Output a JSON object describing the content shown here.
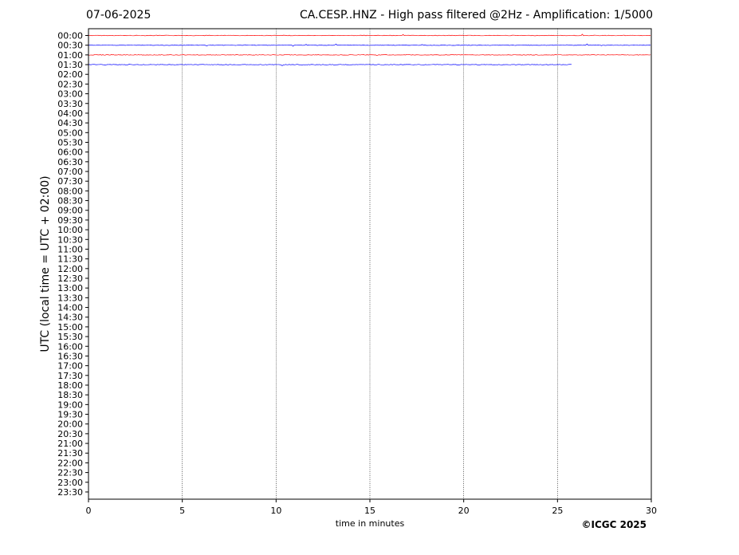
{
  "header": {
    "date": "07-06-2025",
    "title": "CA.CESP..HNZ - High pass filtered @2Hz - Amplification: 1/5000"
  },
  "copyright": "©ICGC 2025",
  "chart_data": {
    "type": "line",
    "title": "CA.CESP..HNZ - High pass filtered @2Hz - Amplification: 1/5000",
    "xlabel": "time in minutes",
    "ylabel": "UTC (local time = UTC + 02:00)",
    "xlim": [
      0,
      30
    ],
    "x_ticks": [
      0,
      5,
      10,
      15,
      20,
      25,
      30
    ],
    "y_tick_labels": [
      "00:00",
      "00:30",
      "01:00",
      "01:30",
      "02:00",
      "02:30",
      "03:00",
      "03:30",
      "04:00",
      "04:30",
      "05:00",
      "05:30",
      "06:00",
      "06:30",
      "07:00",
      "07:30",
      "08:00",
      "08:30",
      "09:00",
      "09:30",
      "10:00",
      "10:30",
      "11:00",
      "11:30",
      "12:00",
      "12:30",
      "13:00",
      "13:30",
      "14:00",
      "14:30",
      "15:00",
      "15:30",
      "16:00",
      "16:30",
      "17:00",
      "17:30",
      "18:00",
      "18:30",
      "19:00",
      "19:30",
      "20:00",
      "20:30",
      "21:00",
      "21:30",
      "22:00",
      "22:30",
      "23:00",
      "23:30"
    ],
    "grid": "vertical dotted at x ticks",
    "series": [
      {
        "row": "00:00",
        "color": "#ff0000",
        "x_start": 0,
        "x_end": 30
      },
      {
        "row": "00:30",
        "color": "#0000ff",
        "x_start": 0,
        "x_end": 30
      },
      {
        "row": "01:00",
        "color": "#ff0000",
        "x_start": 0,
        "x_end": 30
      },
      {
        "row": "01:30",
        "color": "#0000ff",
        "x_start": 0,
        "x_end": 25.8
      }
    ]
  }
}
